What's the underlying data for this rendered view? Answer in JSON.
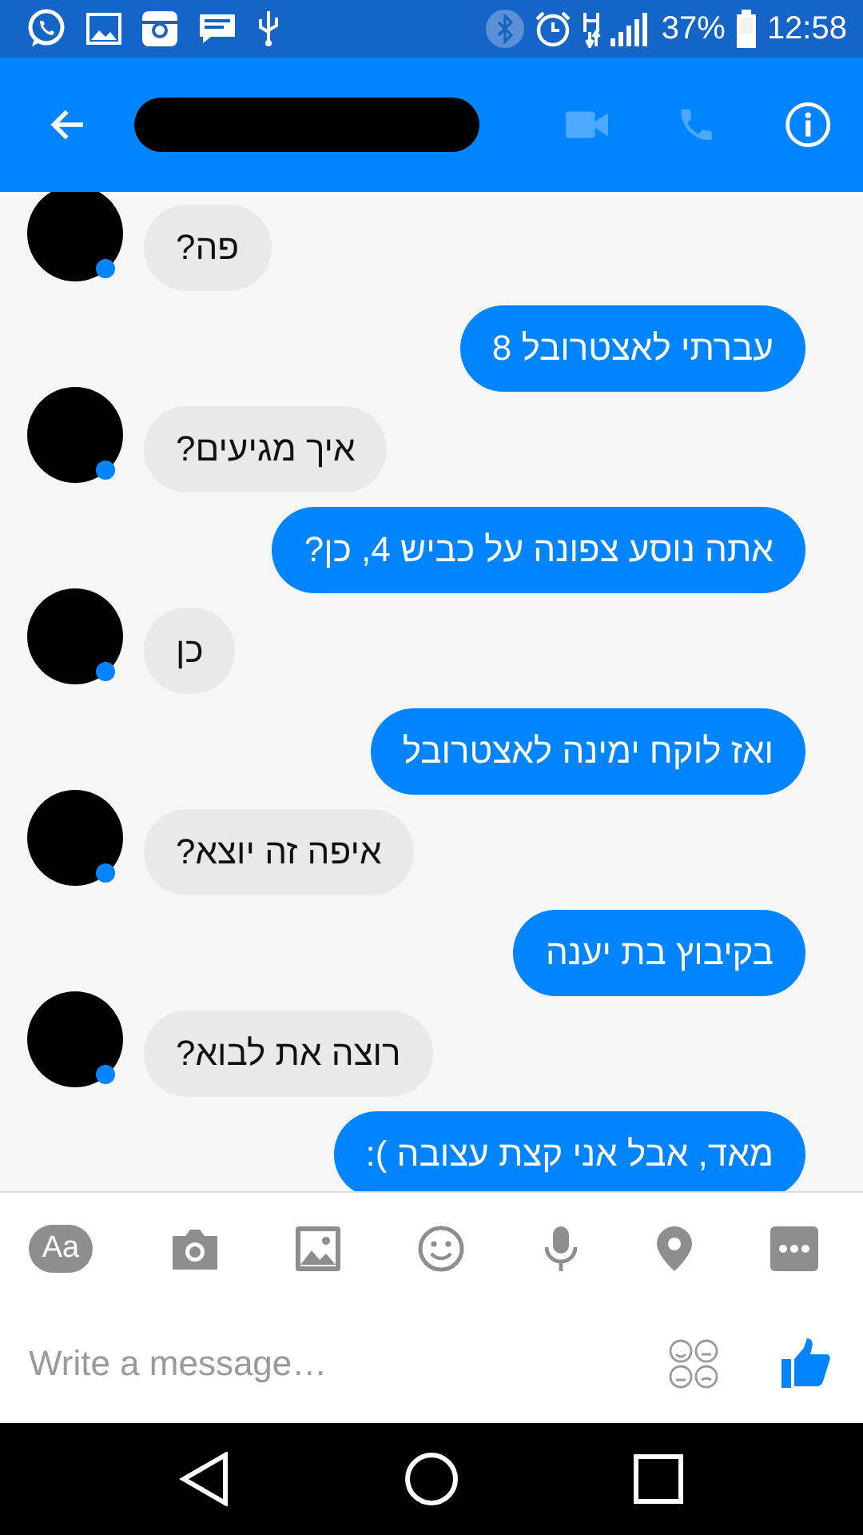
{
  "status_bar": {
    "battery": "37%",
    "time": "12:58"
  },
  "header": {
    "video_call": {
      "disabled": true
    },
    "voice_call": {
      "disabled": true
    }
  },
  "messages": [
    {
      "kind": "incoming",
      "text": "פה?"
    },
    {
      "kind": "outgoing",
      "text": "עברתי לאצטרובל 8"
    },
    {
      "kind": "incoming",
      "text": "איך מגיעים?"
    },
    {
      "kind": "outgoing",
      "text": "אתה נוסע צפונה על כביש 4, כן?"
    },
    {
      "kind": "incoming",
      "text": "כן"
    },
    {
      "kind": "outgoing",
      "text": "ואז לוקח ימינה לאצטרובל"
    },
    {
      "kind": "incoming",
      "text": "איפה זה יוצא?"
    },
    {
      "kind": "outgoing",
      "text": "בקיבוץ בת יענה"
    },
    {
      "kind": "incoming",
      "text": "רוצה את לבוא?"
    },
    {
      "kind": "outgoing",
      "text": "מאד, אבל אני קצת עצובה ):"
    }
  ],
  "composer": {
    "text_button": "Aa",
    "placeholder": "Write a message…"
  }
}
